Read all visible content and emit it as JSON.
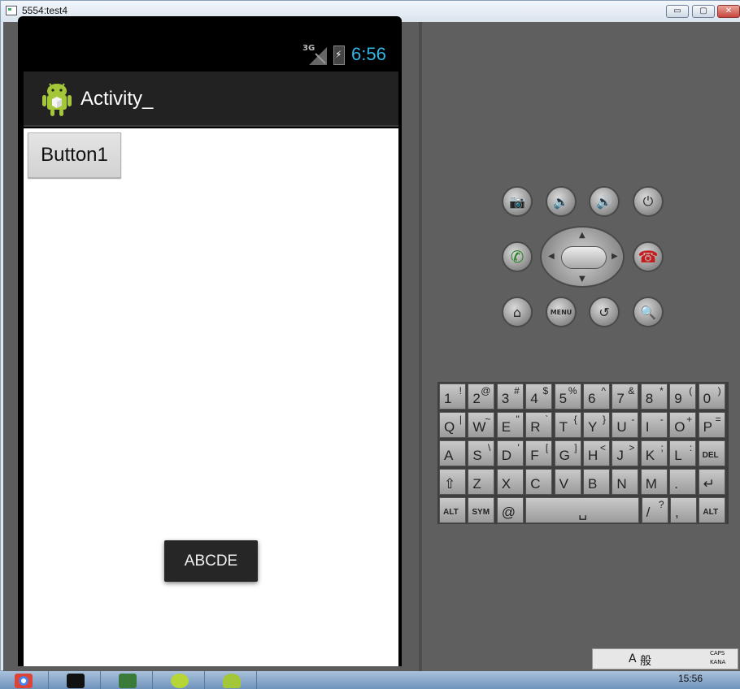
{
  "window": {
    "title": "5554:test4",
    "min": "▭",
    "max": "▢",
    "close": "✕"
  },
  "status": {
    "network": "3G",
    "time": "6:56"
  },
  "app": {
    "title": "Activity_",
    "button1": "Button1",
    "toast": "ABCDE"
  },
  "hardware": {
    "menu": "MENU"
  },
  "keyboard": {
    "row1": [
      [
        "1",
        "!"
      ],
      [
        "2",
        "@"
      ],
      [
        "3",
        "#"
      ],
      [
        "4",
        "$"
      ],
      [
        "5",
        "%"
      ],
      [
        "6",
        "^"
      ],
      [
        "7",
        "&"
      ],
      [
        "8",
        "*"
      ],
      [
        "9",
        "("
      ],
      [
        "0",
        ")"
      ]
    ],
    "row2": [
      [
        "Q",
        "|"
      ],
      [
        "W",
        "~"
      ],
      [
        "E",
        "\""
      ],
      [
        "R",
        "`"
      ],
      [
        "T",
        "{"
      ],
      [
        "Y",
        "}"
      ],
      [
        "U",
        "-"
      ],
      [
        "I",
        "-"
      ],
      [
        "O",
        "+"
      ],
      [
        "P",
        "="
      ]
    ],
    "row3": [
      [
        "A",
        ""
      ],
      [
        "S",
        "\\"
      ],
      [
        "D",
        "'"
      ],
      [
        "F",
        "["
      ],
      [
        "G",
        "]"
      ],
      [
        "H",
        "<"
      ],
      [
        "J",
        ">"
      ],
      [
        "K",
        ";"
      ],
      [
        "L",
        ":"
      ],
      [
        "DEL",
        ""
      ]
    ],
    "row4": [
      [
        "⇧",
        ""
      ],
      [
        "Z",
        ""
      ],
      [
        "X",
        ""
      ],
      [
        "C",
        ""
      ],
      [
        "V",
        ""
      ],
      [
        "B",
        ""
      ],
      [
        "N",
        ""
      ],
      [
        "M",
        ""
      ],
      [
        ".",
        ""
      ],
      [
        "↵",
        ""
      ]
    ],
    "row5": [
      [
        "ALT",
        ""
      ],
      [
        "SYM",
        ""
      ],
      [
        "@",
        ""
      ],
      [
        "␣",
        ""
      ],
      [
        "/",
        "?"
      ],
      [
        ",",
        ""
      ],
      [
        "ALT",
        ""
      ]
    ]
  },
  "taskbar": {
    "time": "15:56"
  },
  "ime": {
    "a": "A",
    "kanji": "般",
    "caps": "CAPS",
    "kana": "KANA"
  }
}
